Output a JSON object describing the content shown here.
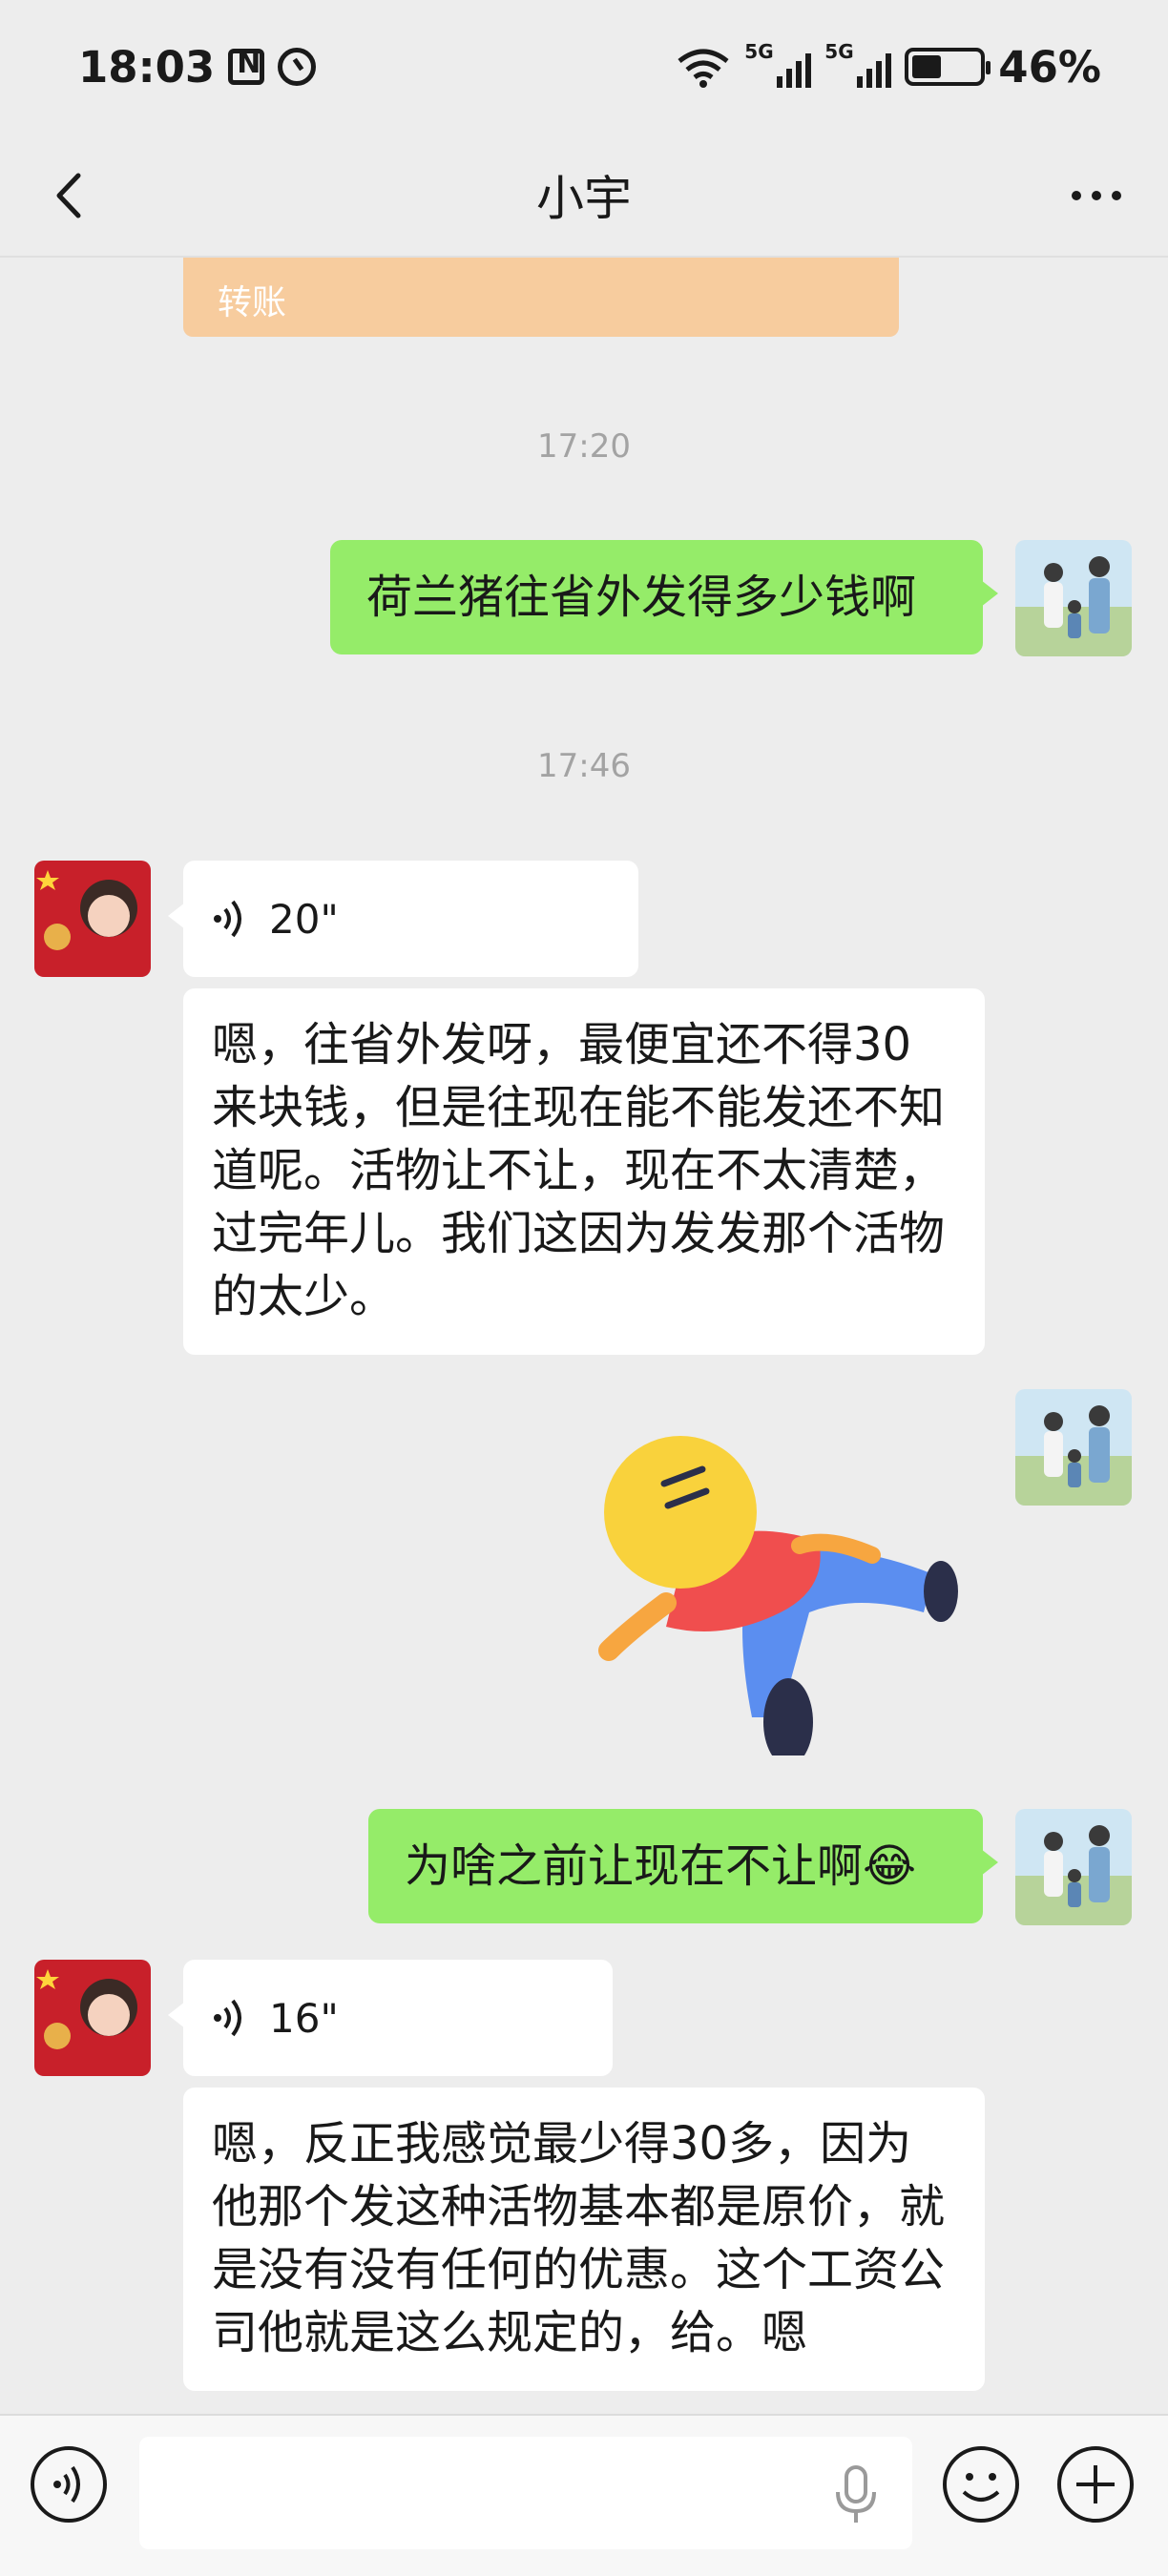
{
  "status_bar": {
    "time": "18:03",
    "network_1": "5G",
    "network_2": "5G",
    "battery": "46%"
  },
  "header": {
    "title": "小宇",
    "back_icon": "chevron-left-icon",
    "more_icon": "more-dots-icon"
  },
  "messages": {
    "transfer_label": "转账",
    "time_1": "17:20",
    "msg_1": "荷兰猪往省外发得多少钱啊",
    "time_2": "17:46",
    "voice_1_duration": "20\"",
    "voice_1_text": "嗯，往省外发呀，最便宜还不得30来块钱，但是往现在能不能发还不知道呢。活物让不让，现在不太清楚，过完年儿。我们这因为发发那个活物的太少。",
    "sticker_name": "lying-down-sticker",
    "msg_2": "为啥之前让现在不让啊😂",
    "voice_2_duration": "16\"",
    "voice_2_text": "嗯，反正我感觉最少得30多，因为他那个发这种活物基本都是原价，就是没有没有任何的优惠。这个工资公司他就是这么规定的，给。嗯"
  },
  "input_bar": {
    "text_value": "",
    "voice_icon": "voice-toggle-icon",
    "emoji_icon": "emoji-icon",
    "plus_icon": "plus-icon"
  },
  "colors": {
    "outgoing_bubble": "#95ec69",
    "incoming_bubble": "#ffffff",
    "transfer": "#f7cc9e",
    "background": "#ededed"
  }
}
